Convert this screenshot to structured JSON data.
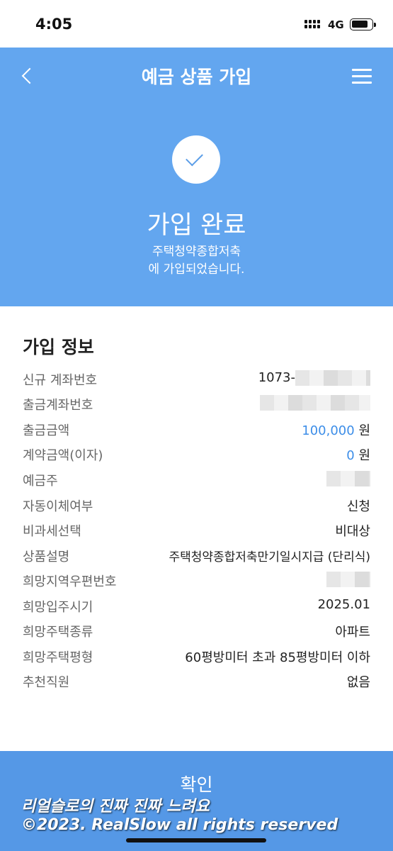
{
  "status_bar": {
    "time": "4:05",
    "network": "4G",
    "battery_level": 0.85
  },
  "header": {
    "title": "예금 상품 가입",
    "back_icon": "chevron-left-icon",
    "menu_icon": "hamburger-menu-icon",
    "check_icon": "checkmark-icon",
    "done_title": "가입 완료",
    "done_line1": "주택청약종합저축",
    "done_line2": "에 가입되었습니다."
  },
  "info": {
    "title": "가입 정보",
    "rows": [
      {
        "label": "신규 계좌번호",
        "value": "1073-"
      },
      {
        "label": "출금계좌번호",
        "value": ""
      },
      {
        "label": "출금금액",
        "value": "100,000",
        "unit": "원"
      },
      {
        "label": "계약금액(이자)",
        "value": "0",
        "unit": "원"
      },
      {
        "label": "예금주",
        "value": ""
      },
      {
        "label": "자동이체여부",
        "value": "신청"
      },
      {
        "label": "비과세선택",
        "value": "비대상"
      },
      {
        "label": "상품설명",
        "value": "주택청약종합저축만기일시지급 (단리식)"
      },
      {
        "label": "희망지역우편번호",
        "value": ""
      },
      {
        "label": "희망입주시기",
        "value": "2025.01"
      },
      {
        "label": "희망주택종류",
        "value": "아파트"
      },
      {
        "label": "희망주택평형",
        "value": "60평방미터 초과 85평방미터 이하"
      },
      {
        "label": "추천직원",
        "value": "없음"
      }
    ]
  },
  "confirm_button": {
    "label": "확인"
  },
  "watermark": {
    "line1": "리얼슬로의 진짜 진짜 느려요",
    "line2": "©2023. RealSlow all rights reserved"
  },
  "colors": {
    "header_bg": "#63a6ef",
    "button_bg": "#5598e6",
    "accent": "#3d8ee8"
  }
}
